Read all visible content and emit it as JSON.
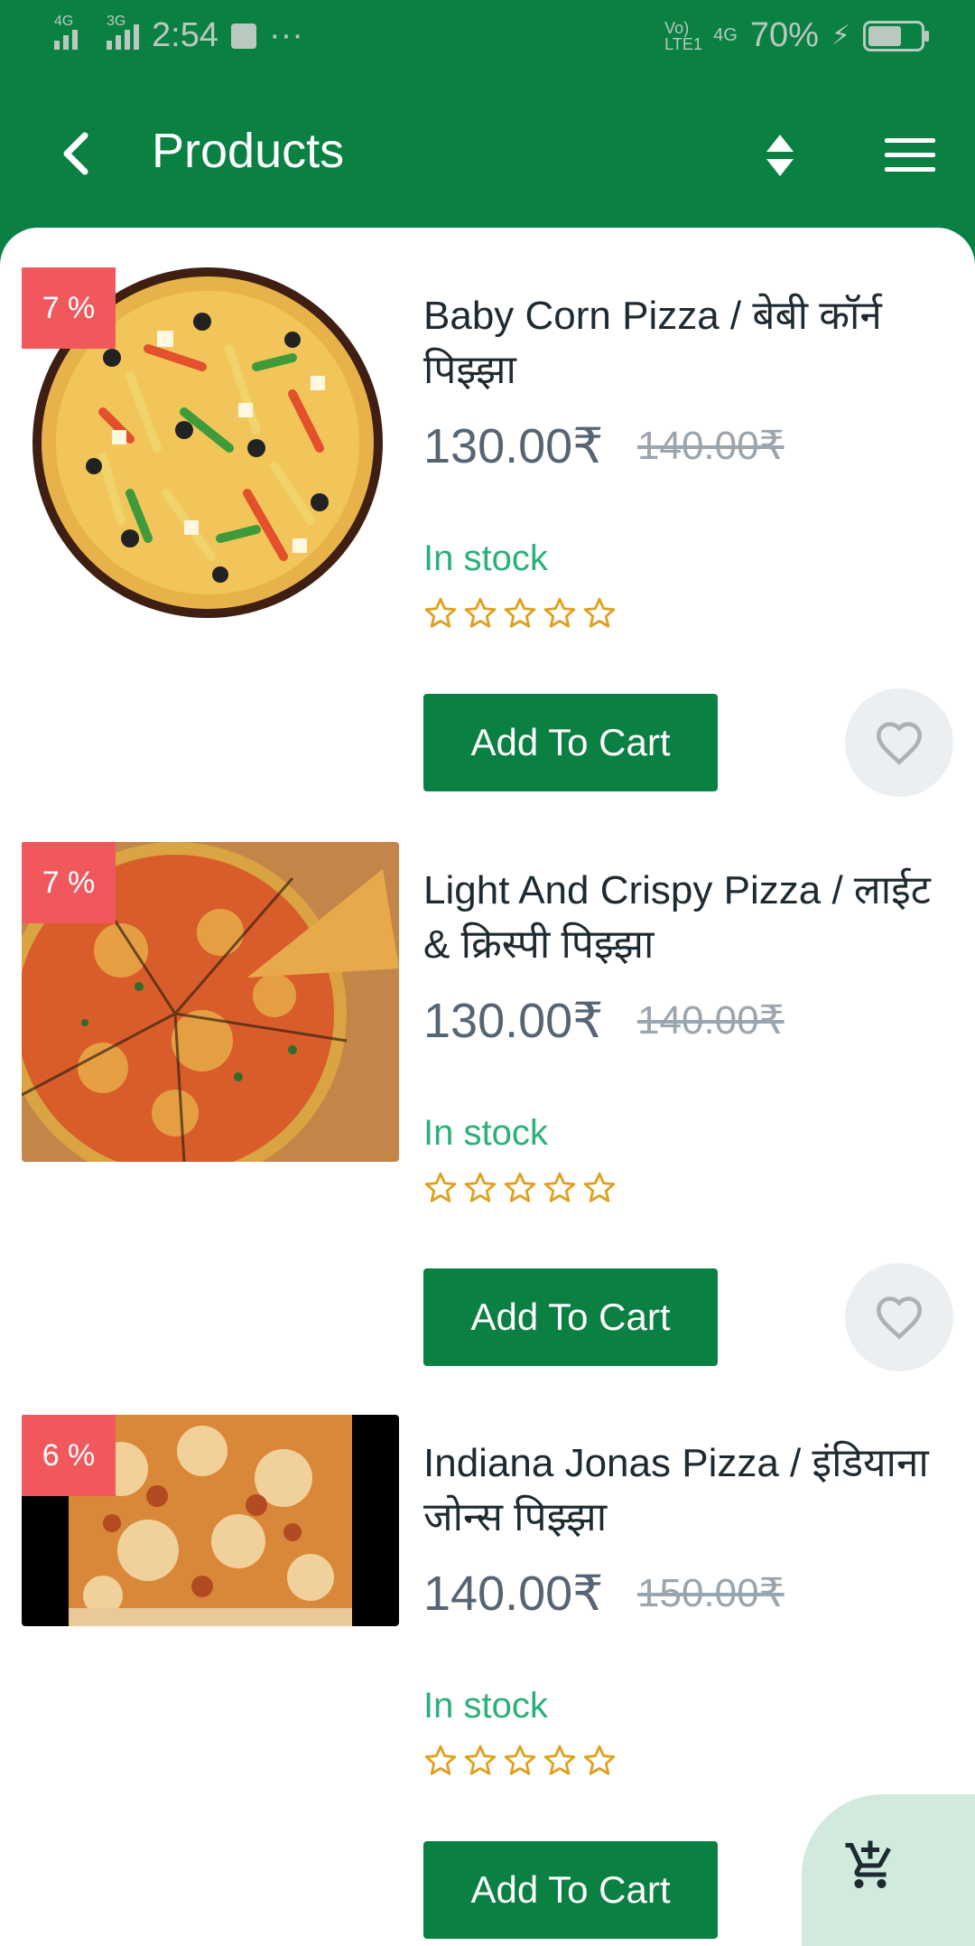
{
  "status_bar": {
    "left_net_1": "4G",
    "left_net_2": "3G",
    "time": "2:54",
    "dots": "···",
    "right_volte": "Vo) LTE1",
    "right_net": "4G",
    "battery_pct": "70%",
    "battery_level": 0.7
  },
  "app_bar": {
    "title": "Products"
  },
  "products": [
    {
      "discount": "7 %",
      "name": "Baby Corn Pizza / बेबी कॉर्न पिझ्झा",
      "price": "130.00₹",
      "old_price": "140.00₹",
      "stock": "In stock",
      "rating": 0,
      "add_to_cart": "Add To Cart"
    },
    {
      "discount": "7 %",
      "name": "Light And Crispy Pizza / लाईट & क्रिस्पी पिझ्झा",
      "price": "130.00₹",
      "old_price": "140.00₹",
      "stock": "In stock",
      "rating": 0,
      "add_to_cart": "Add To Cart"
    },
    {
      "discount": "6 %",
      "name": "Indiana Jonas Pizza / इंडियाना जोन्स पिझ्झा",
      "price": "140.00₹",
      "old_price": "150.00₹",
      "stock": "In stock",
      "rating": 0,
      "add_to_cart": "Add To Cart"
    }
  ],
  "colors": {
    "primary": "#0a8043",
    "badge": "#f1585c",
    "stock": "#2bb079",
    "star": "#e0a020"
  },
  "icons": {
    "back": "chevron-left-icon",
    "sort": "sort-icon",
    "menu": "hamburger-menu-icon",
    "favorite": "heart-outline-icon",
    "cart": "add-shopping-cart-icon"
  }
}
